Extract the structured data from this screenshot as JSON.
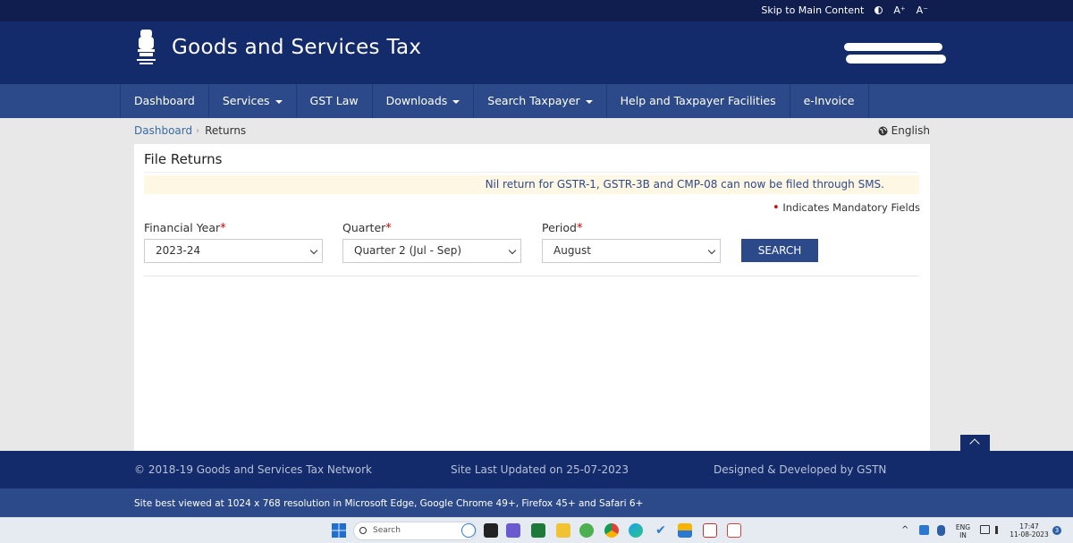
{
  "topbar": {
    "skip_link": "Skip to Main Content",
    "font_increase": "A⁺",
    "font_decrease": "A⁻"
  },
  "header": {
    "title": "Goods and Services Tax"
  },
  "nav": [
    {
      "label": "Dashboard"
    },
    {
      "label": "Services"
    },
    {
      "label": "GST Law"
    },
    {
      "label": "Downloads"
    },
    {
      "label": "Search Taxpayer"
    },
    {
      "label": "Help and Taxpayer Facilities"
    },
    {
      "label": "e-Invoice"
    }
  ],
  "breadcrumb": {
    "home": "Dashboard",
    "current": "Returns"
  },
  "language": "English",
  "panel": {
    "title": "File Returns",
    "notice": "Nil return for GSTR-1, GSTR-3B and CMP-08 can now be filed through SMS.",
    "mandatory": "Indicates Mandatory Fields",
    "fields": {
      "financial_year": {
        "label": "Financial Year",
        "value": "2023-24"
      },
      "quarter": {
        "label": "Quarter",
        "value": "Quarter 2 (Jul - Sep)"
      },
      "period": {
        "label": "Period",
        "value": "August"
      }
    },
    "search_button": "SEARCH"
  },
  "footer": {
    "copyright": "© 2018-19 Goods and Services Tax Network",
    "updated": "Site Last Updated on 25-07-2023",
    "designed": "Designed & Developed by GSTN",
    "browsers": "Site best viewed at 1024 x 768 resolution in Microsoft Edge, Google Chrome 49+, Firefox 45+ and Safari 6+"
  },
  "taskbar": {
    "search_placeholder": "Search",
    "lang_line1": "ENG",
    "lang_line2": "IN",
    "time": "17:47",
    "date": "11-08-2023",
    "notification_count": "3"
  },
  "colors": {
    "header_dark": "#132a6b",
    "nav_blue": "#2c4a8a",
    "notice_bg": "#fdf7e3",
    "mandatory_red": "#d50000"
  }
}
